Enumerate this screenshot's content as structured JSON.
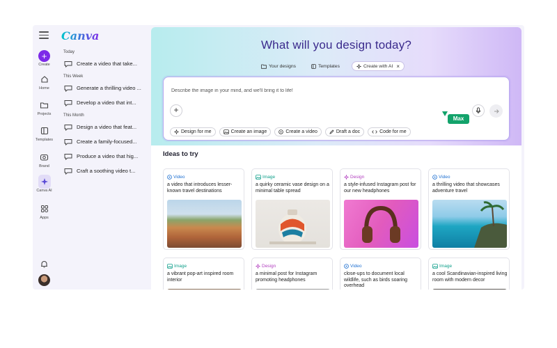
{
  "brand": {
    "logo_text": "Canva"
  },
  "rail": {
    "items": [
      {
        "label": "Create"
      },
      {
        "label": "Home"
      },
      {
        "label": "Projects"
      },
      {
        "label": "Templates"
      },
      {
        "label": "Brand"
      },
      {
        "label": "Canva AI"
      },
      {
        "label": "Apps"
      }
    ]
  },
  "history": {
    "groups": [
      {
        "label": "Today",
        "items": [
          "Create a video that take..."
        ]
      },
      {
        "label": "This Week",
        "items": [
          "Generate a thrilling video ...",
          "Develop a video that int..."
        ]
      },
      {
        "label": "This Month",
        "items": [
          "Design a video that feat...",
          "Create a family-focused...",
          "Produce a video that hig...",
          "Craft a soothing video t..."
        ]
      }
    ]
  },
  "main": {
    "title": "What will you design today?",
    "tabs": [
      {
        "label": "Your designs"
      },
      {
        "label": "Templates"
      },
      {
        "label": "Create with AI",
        "close_icon": "×"
      }
    ],
    "prompt": {
      "placeholder": "Describe the image in your mind, and we'll bring it to life!",
      "cursor_label": "Max",
      "suggestions": [
        "Design for me",
        "Create an image",
        "Create a video",
        "Draft a doc",
        "Code for me"
      ]
    },
    "ideas_title": "Ideas to try",
    "ideas": [
      {
        "type": "Video",
        "text": "a video that introduces lesser-known travel destinations"
      },
      {
        "type": "Image",
        "text": "a quirky ceramic vase design on a minimal table spread"
      },
      {
        "type": "Design",
        "text": "a style-infused Instagram post for our new headphones"
      },
      {
        "type": "Video",
        "text": "a thrilling video that showcases adventure travel"
      },
      {
        "type": "Image",
        "text": "a vibrant pop-art inspired room interior"
      },
      {
        "type": "Design",
        "text": "a minimal post for Instagram promoting headphones"
      },
      {
        "type": "Video",
        "text": "close-ups to document local wildlife, such as birds soaring overhead"
      },
      {
        "type": "Image",
        "text": "a cool Scandinavian-inspired living room with modern decor"
      }
    ]
  },
  "colors": {
    "accent": "#7d2ae8",
    "title": "#3a2a8c",
    "video_tag": "#1d6fd1",
    "image_tag": "#0e9f8a",
    "design_tag": "#b23fbf",
    "cursor_tag": "#13a36b"
  },
  "icons": {
    "menu": "menu-icon",
    "create": "plus-icon",
    "home": "home-icon",
    "projects": "folder-icon",
    "templates": "templates-icon",
    "brand": "brand-icon",
    "canva_ai": "sparkle-icon",
    "apps": "apps-icon",
    "notifications": "bell-icon",
    "chat": "chat-bubble-icon",
    "mic": "mic-icon",
    "send": "arrow-right-icon"
  }
}
